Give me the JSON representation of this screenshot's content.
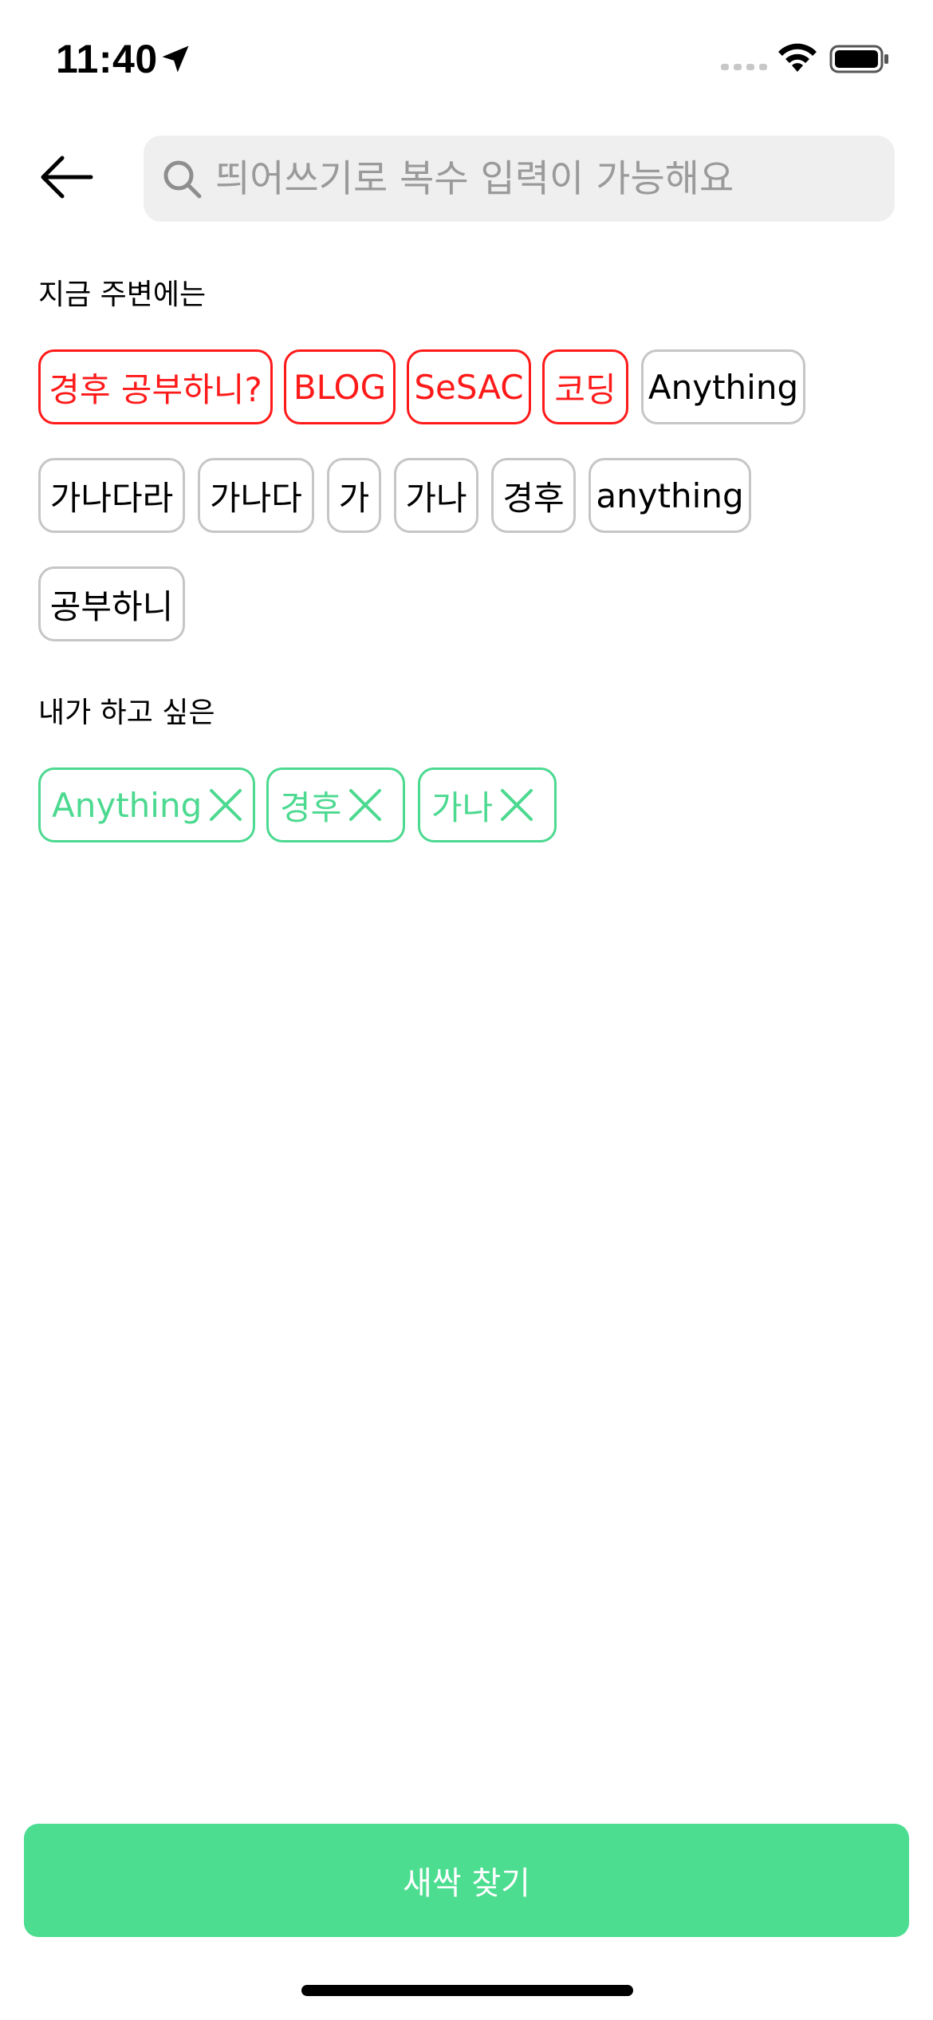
{
  "status_bar": {
    "time": "11:40"
  },
  "search": {
    "placeholder": "띄어쓰기로 복수 입력이 가능해요",
    "value": ""
  },
  "nearby": {
    "title": "지금 주변에는",
    "recommended": [
      "경후 공부하니?",
      "BLOG",
      "SeSAC",
      "코딩"
    ],
    "others": [
      "Anything",
      "가나다라",
      "가나다",
      "가",
      "가나",
      "경후",
      "anything",
      "공부하니"
    ]
  },
  "wish": {
    "title": "내가 하고 싶은",
    "items": [
      "Anything",
      "경후",
      "가나"
    ]
  },
  "primary_button": {
    "label": "새싹 찾기"
  },
  "colors": {
    "recommended": "#ff1a1a",
    "accent": "#4cdd90",
    "chip_border": "#c6c6c6",
    "search_bg": "#efefef"
  },
  "icons": {
    "back": "arrow-left-icon",
    "search": "magnifier-icon",
    "remove": "close-icon",
    "location": "location-arrow-icon",
    "wifi": "wifi-icon",
    "battery": "battery-icon",
    "signal": "signal-icon"
  }
}
